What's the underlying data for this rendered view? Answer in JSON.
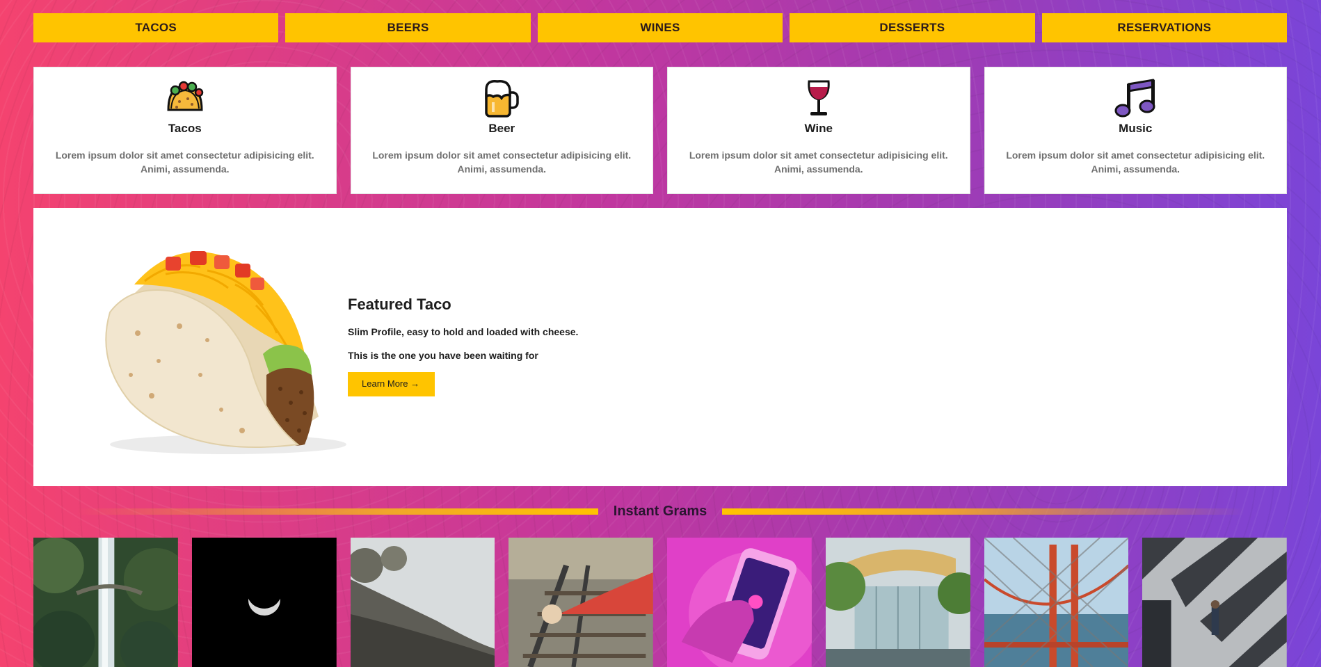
{
  "nav": {
    "items": [
      "TACOS",
      "BEERS",
      "WINES",
      "DESSERTS",
      "RESERVATIONS"
    ],
    "color": "#ffc400"
  },
  "cards": [
    {
      "title": "Tacos",
      "icon": "taco-icon",
      "text": "Lorem ipsum dolor sit amet consectetur adipisicing elit. Animi, assumenda."
    },
    {
      "title": "Beer",
      "icon": "beer-mug-icon",
      "text": "Lorem ipsum dolor sit amet consectetur adipisicing elit. Animi, assumenda."
    },
    {
      "title": "Wine",
      "icon": "wine-glass-icon",
      "text": "Lorem ipsum dolor sit amet consectetur adipisicing elit. Animi, assumenda."
    },
    {
      "title": "Music",
      "icon": "music-note-icon",
      "text": "Lorem ipsum dolor sit amet consectetur adipisicing elit. Animi, assumenda."
    }
  ],
  "feature": {
    "title": "Featured Taco",
    "line1": "Slim Profile, easy to hold and loaded with cheese.",
    "line2": "This is the one you have been waiting for",
    "button": "Learn More →",
    "image": "taco-photo"
  },
  "grams": {
    "title": "Instant Grams",
    "photos": [
      "waterfall-photo",
      "moon-photo",
      "foggy-hillside-photo",
      "woman-on-tracks-photo",
      "pink-phone-photo",
      "glass-building-photo",
      "golden-gate-bridge-photo",
      "street-shadows-photo"
    ]
  },
  "colors": {
    "accent": "#ffc400",
    "bg_start": "#f4436f",
    "bg_end": "#7a45d8"
  }
}
